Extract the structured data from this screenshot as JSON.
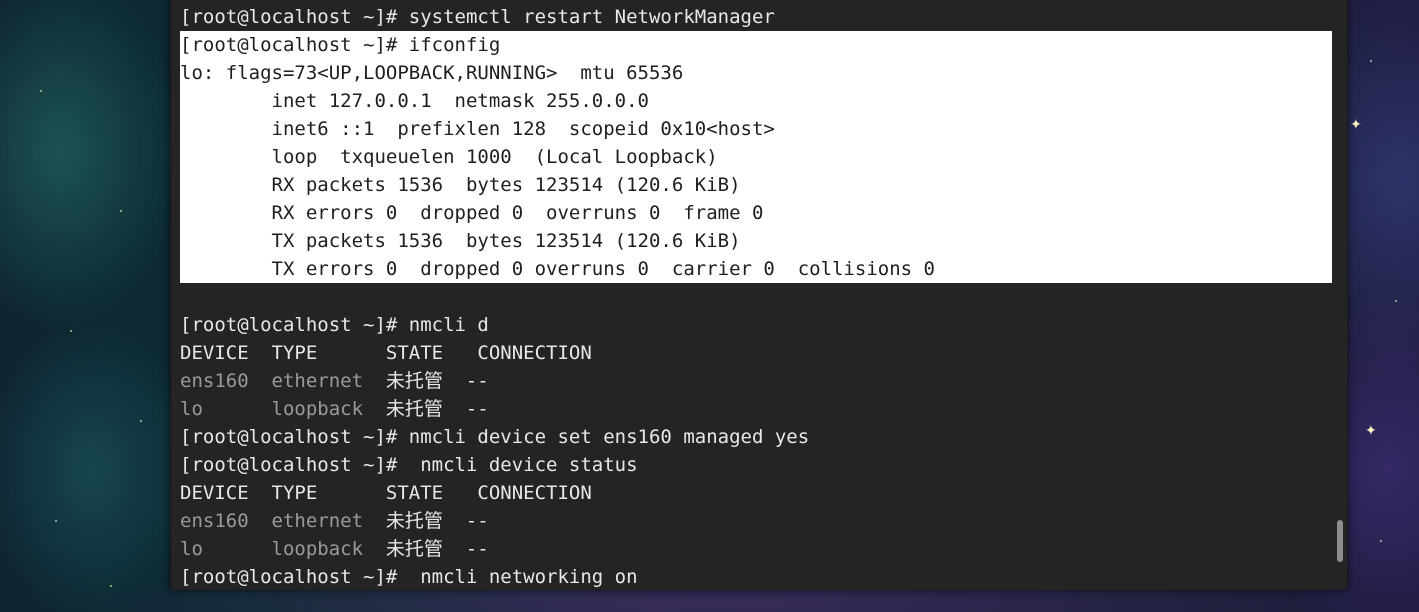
{
  "terminal": {
    "lines": [
      {
        "text": "[root@localhost ~]# systemctl restart NetworkManager",
        "selected": false
      },
      {
        "text": "[root@localhost ~]# ifconfig",
        "selected": true
      },
      {
        "text": "lo: flags=73<UP,LOOPBACK,RUNNING>  mtu 65536",
        "selected": true
      },
      {
        "text": "        inet 127.0.0.1  netmask 255.0.0.0",
        "selected": true
      },
      {
        "text": "        inet6 ::1  prefixlen 128  scopeid 0x10<host>",
        "selected": true
      },
      {
        "text": "        loop  txqueuelen 1000  (Local Loopback)",
        "selected": true
      },
      {
        "text": "        RX packets 1536  bytes 123514 (120.6 KiB)",
        "selected": true
      },
      {
        "text": "        RX errors 0  dropped 0  overruns 0  frame 0",
        "selected": true
      },
      {
        "text": "        TX packets 1536  bytes 123514 (120.6 KiB)",
        "selected": true
      },
      {
        "text": "        TX errors 0  dropped 0 overruns 0  carrier 0  collisions 0",
        "selected": true
      },
      {
        "text": "",
        "selected": false
      },
      {
        "text": "[root@localhost ~]# nmcli d",
        "selected": false
      },
      {
        "text": "DEVICE  TYPE      STATE   CONNECTION",
        "selected": false
      },
      {
        "dim": "ens160  ethernet",
        "text": "  未托管  --",
        "selected": false
      },
      {
        "dim": "lo      loopback",
        "text": "  未托管  --",
        "selected": false
      },
      {
        "text": "[root@localhost ~]# nmcli device set ens160 managed yes",
        "selected": false
      },
      {
        "text": "[root@localhost ~]#  nmcli device status",
        "selected": false
      },
      {
        "text": "DEVICE  TYPE      STATE   CONNECTION",
        "selected": false
      },
      {
        "dim": "ens160  ethernet",
        "text": "  未托管  --",
        "selected": false
      },
      {
        "dim": "lo      loopback",
        "text": "  未托管  --",
        "selected": false
      },
      {
        "text": "[root@localhost ~]#  nmcli networking on",
        "selected": false
      }
    ]
  },
  "colors": {
    "terminal_bg": "#242424",
    "text": "#e8e8e8",
    "dim_text": "#9a9a9a",
    "selection_bg": "#ffffff",
    "selection_text": "#1e1e1e"
  }
}
